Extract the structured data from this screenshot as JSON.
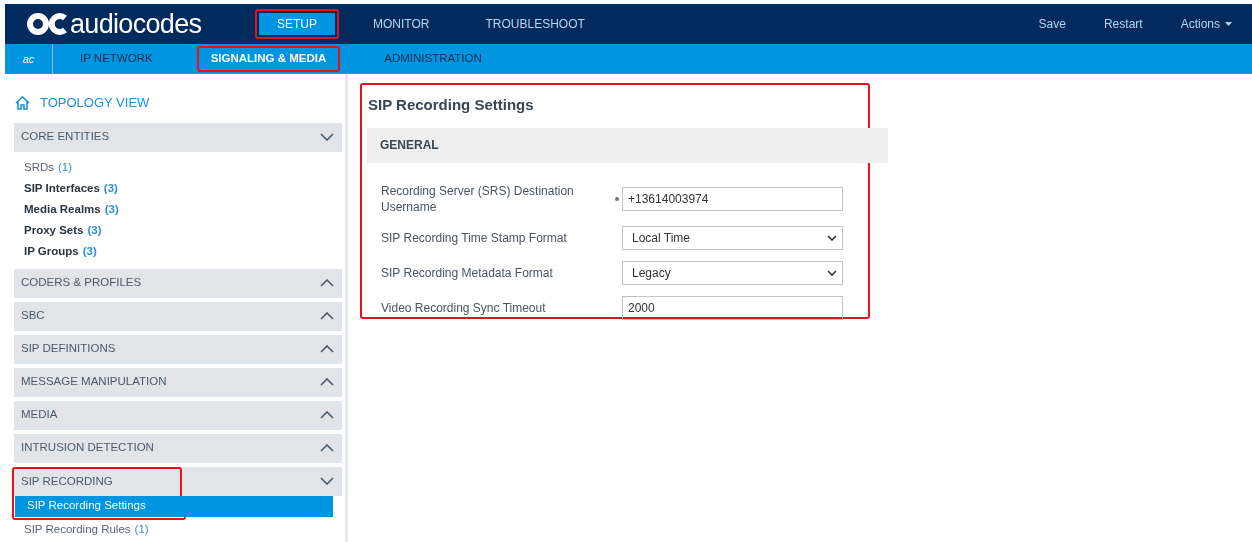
{
  "top_bar": {
    "logo": "audiocodes",
    "tabs": [
      {
        "label": "SETUP",
        "selected": true,
        "highlighted": true
      },
      {
        "label": "MONITOR",
        "selected": false,
        "highlighted": false
      },
      {
        "label": "TROUBLESHOOT",
        "selected": false,
        "highlighted": false
      }
    ],
    "actions": [
      {
        "label": "Save",
        "kind": "link"
      },
      {
        "label": "Restart",
        "kind": "link"
      },
      {
        "label": "Actions",
        "kind": "menu"
      }
    ]
  },
  "sub_bar": {
    "badge": "ac",
    "tabs": [
      {
        "label": "IP NETWORK",
        "selected": false,
        "highlighted": false
      },
      {
        "label": "SIGNALING & MEDIA",
        "selected": true,
        "highlighted": true
      },
      {
        "label": "ADMINISTRATION",
        "selected": false,
        "highlighted": false
      }
    ]
  },
  "sidebar": {
    "topology": "TOPOLOGY VIEW",
    "sections": [
      {
        "title": "CORE ENTITIES",
        "expanded": true,
        "highlighted": false,
        "items": [
          {
            "label": "SRDs",
            "count": "(1)",
            "emphasized": false,
            "selected": false,
            "highlighted": false
          },
          {
            "label": "SIP Interfaces",
            "count": "(3)",
            "emphasized": true,
            "selected": false,
            "highlighted": false
          },
          {
            "label": "Media Realms",
            "count": "(3)",
            "emphasized": true,
            "selected": false,
            "highlighted": false
          },
          {
            "label": "Proxy Sets",
            "count": "(3)",
            "emphasized": true,
            "selected": false,
            "highlighted": false
          },
          {
            "label": "IP Groups",
            "count": "(3)",
            "emphasized": true,
            "selected": false,
            "highlighted": false
          }
        ]
      },
      {
        "title": "CODERS & PROFILES",
        "expanded": false,
        "highlighted": false
      },
      {
        "title": "SBC",
        "expanded": false,
        "highlighted": false
      },
      {
        "title": "SIP DEFINITIONS",
        "expanded": false,
        "highlighted": false
      },
      {
        "title": "MESSAGE MANIPULATION",
        "expanded": false,
        "highlighted": false
      },
      {
        "title": "MEDIA",
        "expanded": false,
        "highlighted": false
      },
      {
        "title": "INTRUSION DETECTION",
        "expanded": false,
        "highlighted": false
      },
      {
        "title": "SIP RECORDING",
        "expanded": true,
        "highlighted": true,
        "items": [
          {
            "label": "SIP Recording Settings",
            "emphasized": false,
            "selected": true,
            "highlighted": true
          },
          {
            "label": "SIP Recording Rules",
            "count": "(1)",
            "emphasized": false,
            "selected": false,
            "highlighted": false
          }
        ]
      }
    ]
  },
  "panel": {
    "title": "SIP Recording Settings",
    "highlighted": true,
    "group": "GENERAL",
    "fields": [
      {
        "kind": "text",
        "label": "Recording Server (SRS) Destination Username",
        "value": "+13614003974",
        "required": true
      },
      {
        "kind": "select",
        "label": "SIP Recording Time Stamp Format",
        "value": "Local Time",
        "required": false
      },
      {
        "kind": "select",
        "label": "SIP Recording Metadata Format",
        "value": "Legacy",
        "required": false
      },
      {
        "kind": "text",
        "label": "Video Recording Sync Timeout",
        "value": "2000",
        "required": false
      }
    ]
  }
}
